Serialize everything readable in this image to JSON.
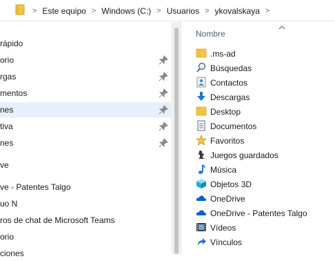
{
  "address_bar": {
    "crumbs": [
      "Este equipo",
      "Windows (C:)",
      "Usuarios",
      "ykovalskaya"
    ]
  },
  "nav_pane": {
    "items": [
      {
        "label": "rápido",
        "pinned": false,
        "selected": false
      },
      {
        "label": "orio",
        "pinned": true,
        "selected": false
      },
      {
        "label": "rgas",
        "pinned": true,
        "selected": false
      },
      {
        "label": "mentos",
        "pinned": true,
        "selected": false
      },
      {
        "label": "nes",
        "pinned": true,
        "selected": true
      },
      {
        "label": "tiva",
        "pinned": true,
        "selected": false
      },
      {
        "label": "nes",
        "pinned": true,
        "selected": false
      },
      {
        "label": "ve",
        "pinned": false,
        "selected": false
      },
      {
        "label": "ve - Patentes Talgo",
        "pinned": false,
        "selected": false
      },
      {
        "label": "uo N",
        "pinned": false,
        "selected": false
      },
      {
        "label": "ros de chat de Microsoft Teams",
        "pinned": false,
        "selected": false
      },
      {
        "label": "orio",
        "pinned": false,
        "selected": false
      },
      {
        "label": "ciones",
        "pinned": false,
        "selected": false
      }
    ],
    "pin_icon": "pin-icon",
    "selection_color": "#e5f0fb"
  },
  "content_pane": {
    "column_header": "Nombre",
    "sort_icon": "chevron-up-icon",
    "files": [
      {
        "name": ".ms-ad",
        "icon": "folder-icon"
      },
      {
        "name": "Búsquedas",
        "icon": "search-folder-icon"
      },
      {
        "name": "Contactos",
        "icon": "contacts-icon"
      },
      {
        "name": "Descargas",
        "icon": "download-icon"
      },
      {
        "name": "Desktop",
        "icon": "folder-icon"
      },
      {
        "name": "Documentos",
        "icon": "documents-icon"
      },
      {
        "name": "Favoritos",
        "icon": "star-icon"
      },
      {
        "name": "Juegos guardados",
        "icon": "chess-icon"
      },
      {
        "name": "Música",
        "icon": "music-icon"
      },
      {
        "name": "Objetos 3D",
        "icon": "cube-icon"
      },
      {
        "name": "OneDrive",
        "icon": "cloud-icon"
      },
      {
        "name": "OneDrive - Patentes Talgo",
        "icon": "cloud-icon"
      },
      {
        "name": "Vídeos",
        "icon": "film-icon"
      },
      {
        "name": "Vínculos",
        "icon": "link-arrow-icon"
      }
    ]
  },
  "colors": {
    "folder": "#f5c343",
    "header_text": "#4c607a",
    "onedrive": "#0a64c8"
  }
}
